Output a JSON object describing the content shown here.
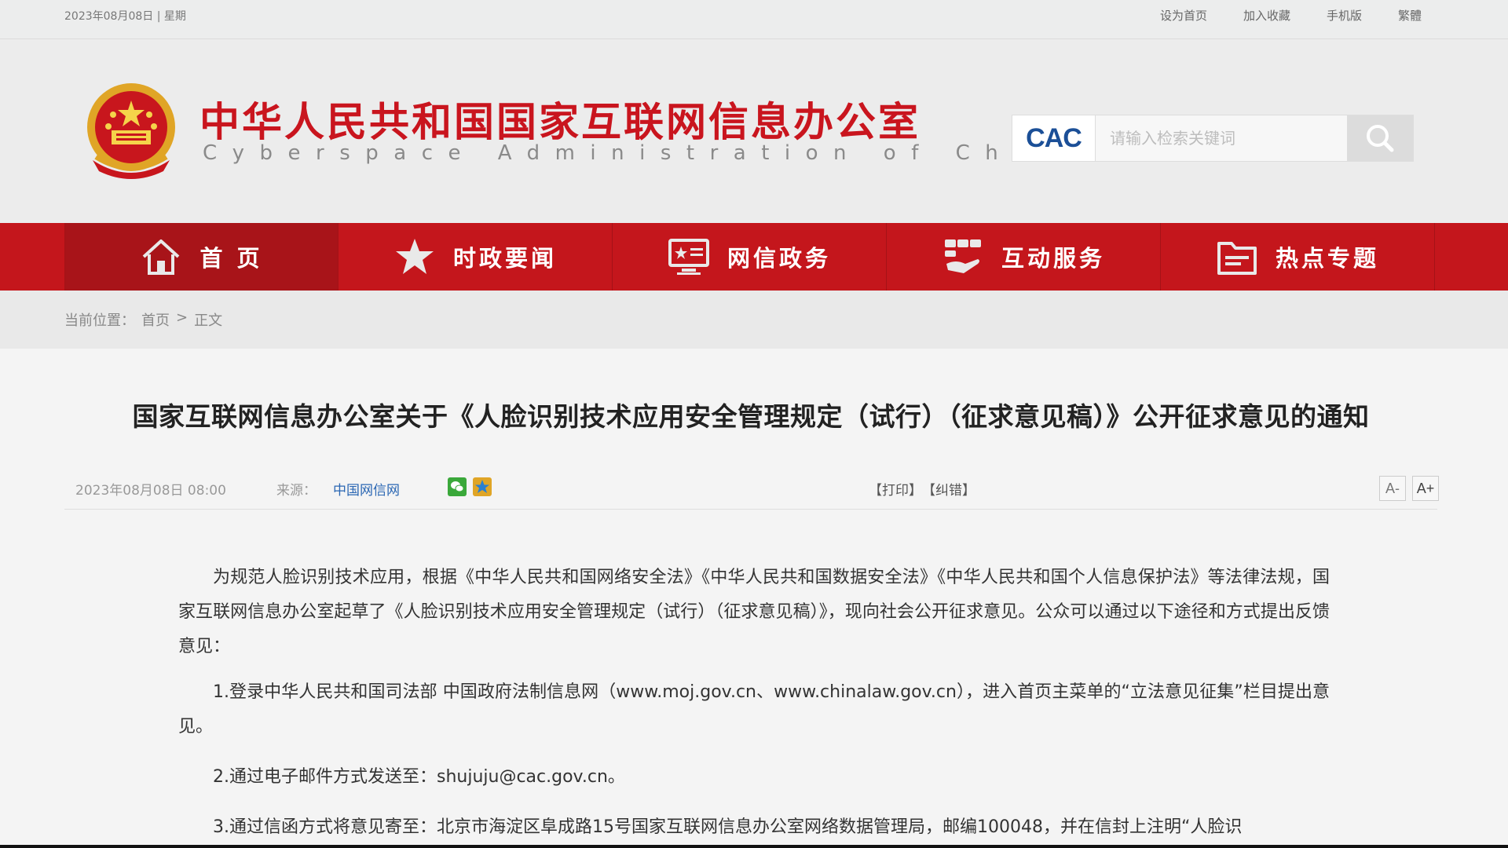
{
  "topbar": {
    "date": "2023年08月08日 | 星期",
    "links": [
      "设为首页",
      "加入收藏",
      "手机版",
      "繁體"
    ]
  },
  "header": {
    "title_cn": "中华人民共和国国家互联网信息办公室",
    "title_en": "Cyberspace Administration of China",
    "logo_text": "CAC",
    "search_placeholder": "请输入检索关键词"
  },
  "nav": {
    "items": [
      {
        "label": "首 页",
        "icon": "home-icon"
      },
      {
        "label": "时政要闻",
        "icon": "star-icon"
      },
      {
        "label": "网信政务",
        "icon": "monitor-icon"
      },
      {
        "label": "互动服务",
        "icon": "handshake-icon"
      },
      {
        "label": "热点专题",
        "icon": "folder-icon"
      }
    ]
  },
  "breadcrumb": {
    "label": "当前位置：",
    "home": "首页",
    "sep": ">",
    "current": "正文"
  },
  "article": {
    "title": "国家互联网信息办公室关于《人脸识别技术应用安全管理规定（试行）（征求意见稿）》公开征求意见的通知",
    "time": "2023年08月08日 08:00",
    "source_label": "来源：",
    "source": "中国网信网",
    "print": "【打印】",
    "error": "【纠错】",
    "font_small": "A-",
    "font_large": "A+",
    "paragraphs": [
      "为规范人脸识别技术应用，根据《中华人民共和国网络安全法》《中华人民共和国数据安全法》《中华人民共和国个人信息保护法》等法律法规，国家互联网信息办公室起草了《人脸识别技术应用安全管理规定（试行）（征求意见稿）》，现向社会公开征求意见。公众可以通过以下途径和方式提出反馈意见：",
      "1.登录中华人民共和国司法部 中国政府法制信息网（www.moj.gov.cn、www.chinalaw.gov.cn），进入首页主菜单的“立法意见征集”栏目提出意见。",
      "2.通过电子邮件方式发送至：shujuju@cac.gov.cn。",
      "3.通过信函方式将意见寄至：北京市海淀区阜成路15号国家互联网信息办公室网络数据管理局，邮编100048，并在信封上注明“人脸识"
    ]
  },
  "colors": {
    "brand_red": "#c4161c",
    "nav_active": "#a81419",
    "link_blue": "#2a66b3",
    "cac_blue": "#1b4f97"
  }
}
